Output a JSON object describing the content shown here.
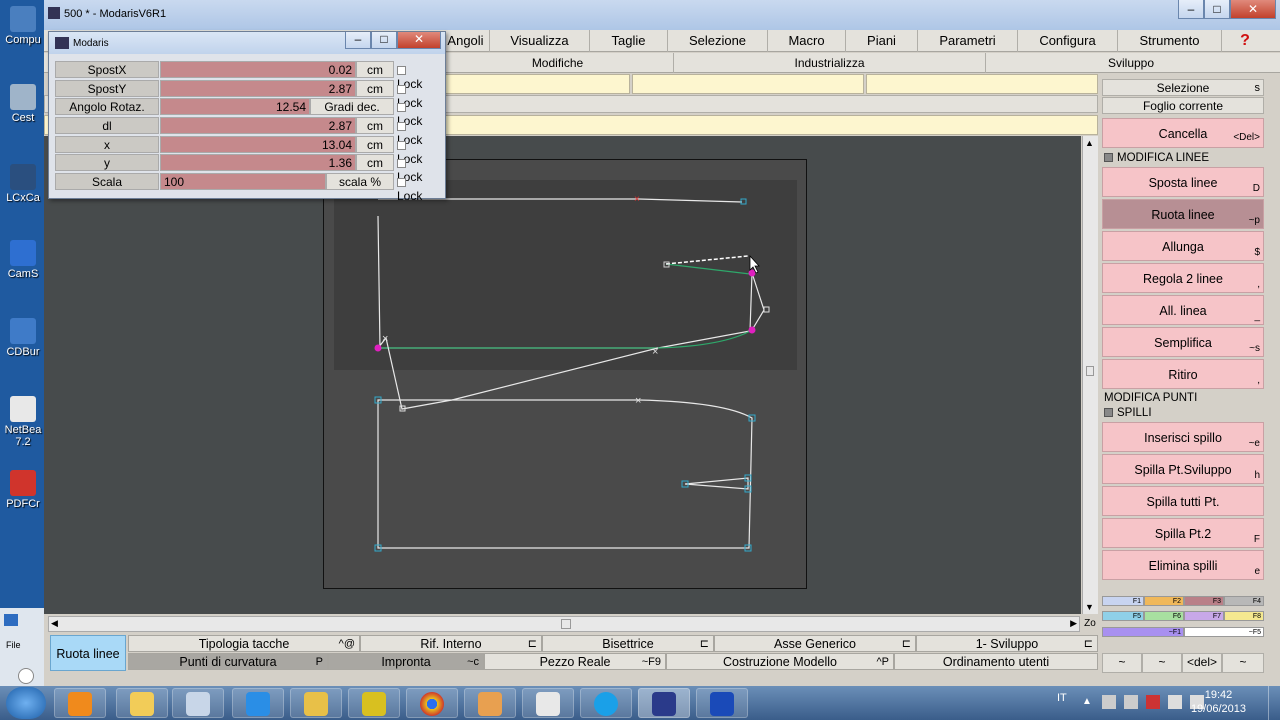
{
  "desktop_icons": [
    "Compu",
    "Cest",
    "LCxCa",
    "CamS",
    "CDBur",
    "NetBea\n7.2",
    "PDFCr"
  ],
  "window": {
    "title": "500 * - ModarisV6R1"
  },
  "menus": [
    "Angoli",
    "Visualizza",
    "Taglie",
    "Selezione",
    "Macro",
    "Piani",
    "Parametri",
    "Configura",
    "Strumento"
  ],
  "help_label": "?",
  "submenus": [
    "Modifiche",
    "Industrializza",
    "Sviluppo"
  ],
  "dialog": {
    "title": "Modaris",
    "rows": [
      {
        "label": "SpostX",
        "value": "0.02",
        "unit": "cm",
        "lock": "Lock"
      },
      {
        "label": "SpostY",
        "value": "2.87",
        "unit": "cm",
        "lock": "Lock"
      },
      {
        "label": "Angolo Rotaz.",
        "value": "12.54",
        "unit": "Gradi dec.",
        "lock": "Lock"
      },
      {
        "label": "dl",
        "value": "2.87",
        "unit": "cm",
        "lock": "Lock"
      },
      {
        "label": "x",
        "value": "13.04",
        "unit": "cm",
        "lock": "Lock"
      },
      {
        "label": "y",
        "value": "1.36",
        "unit": "cm",
        "lock": "Lock"
      },
      {
        "label": "Scala",
        "value": "100",
        "unit": "scala %",
        "lock": "Lock"
      }
    ]
  },
  "right_panel": {
    "selezione": "Selezione",
    "selezione_sc": "s",
    "foglio": "Foglio corrente",
    "cancella": "Cancella",
    "cancella_sc": "<Del>",
    "modifica_linee": "MODIFICA LINEE",
    "sposta_linee": "Sposta linee",
    "sposta_linee_sc": "D",
    "ruota_linee": "Ruota linee",
    "ruota_linee_sc": "~p",
    "allunga": "Allunga",
    "allunga_sc": "$",
    "regola": "Regola 2 linee",
    "regola_sc": ",",
    "all_linea": "All. linea",
    "all_linea_sc": "_",
    "semplifica": "Semplifica",
    "semplifica_sc": "~s",
    "ritiro": "Ritiro",
    "ritiro_sc": ",",
    "modifica_punti": "MODIFICA PUNTI",
    "spilli": "SPILLI",
    "inserisci": "Inserisci spillo",
    "inserisci_sc": "~e",
    "spilla_sviluppo": "Spilla Pt.Sviluppo",
    "spilla_sviluppo_sc": "h",
    "spilla_tutti": "Spilla tutti Pt.",
    "spilla_pt2": "Spilla Pt.2",
    "spilla_pt2_sc": "F",
    "elimina": "Elimina spilli",
    "elimina_sc": "e",
    "swatches": [
      "F1",
      "F2",
      "F3",
      "F4",
      "F5",
      "F6",
      "F7",
      "F8",
      "~F1",
      "~F5"
    ],
    "bottom_keys": [
      "~",
      "~",
      "<del>",
      "~"
    ]
  },
  "bottom": {
    "main": "Ruota linee",
    "row1": [
      {
        "label": "Tipologia tacche",
        "sc": "^@"
      },
      {
        "label": "Rif. Interno",
        "sc": "⊏"
      },
      {
        "label": "Bisettrice",
        "sc": "⊏"
      },
      {
        "label": "Asse Generico",
        "sc": "⊏"
      },
      {
        "label": "1- Sviluppo",
        "sc": "⊏"
      }
    ],
    "row2": [
      {
        "label": "Punti di curvatura",
        "sc": "P"
      },
      {
        "label": "Impronta",
        "sc": "~c"
      },
      {
        "label": "Pezzo Reale",
        "sc": "~F9"
      },
      {
        "label": "Costruzione Modello",
        "sc": "^P"
      },
      {
        "label": "Ordinamento utenti",
        "sc": ""
      }
    ]
  },
  "zoom_label": "Zo",
  "taskbar": {
    "lang": "IT",
    "time": "19:42",
    "date": "19/06/2013"
  },
  "colors": {
    "accent_pink": "#f6c4c8",
    "active_blue": "#a9d9f7",
    "value_red": "#c5898c"
  }
}
